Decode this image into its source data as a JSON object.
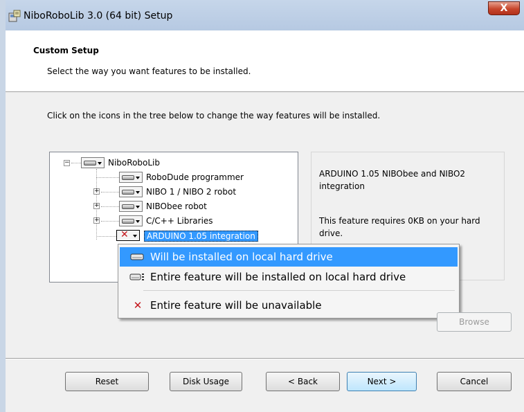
{
  "window": {
    "title": "NiboRoboLib 3.0 (64 bit) Setup",
    "close_label": "X"
  },
  "header": {
    "title": "Custom Setup",
    "subtitle": "Select the way you want features to be installed."
  },
  "instruction": "Click on the icons in the tree below to change the way features will be installed.",
  "tree": {
    "root": "NiboRoboLib",
    "items": [
      {
        "label": "RoboDude programmer"
      },
      {
        "label": "NIBO 1 / NIBO 2 robot"
      },
      {
        "label": "NIBObee robot"
      },
      {
        "label": "C/C++ Libraries"
      },
      {
        "label": "ARDUINO 1.05 integration"
      }
    ]
  },
  "description": {
    "text": "ARDUINO 1.05 NIBObee and NIBO2 integration",
    "requirement": "This feature requires 0KB on your hard drive."
  },
  "context_menu": {
    "items": [
      {
        "label": "Will be installed on local hard drive"
      },
      {
        "label": "Entire feature will be installed on local hard drive"
      },
      {
        "label": "Entire feature will be unavailable"
      }
    ]
  },
  "buttons": {
    "browse": "Browse",
    "reset": "Reset",
    "disk_usage": "Disk Usage",
    "back": "< Back",
    "next": "Next >",
    "cancel": "Cancel"
  },
  "colors": {
    "selection": "#3399ff",
    "unavailable_x": "#c4161c"
  }
}
